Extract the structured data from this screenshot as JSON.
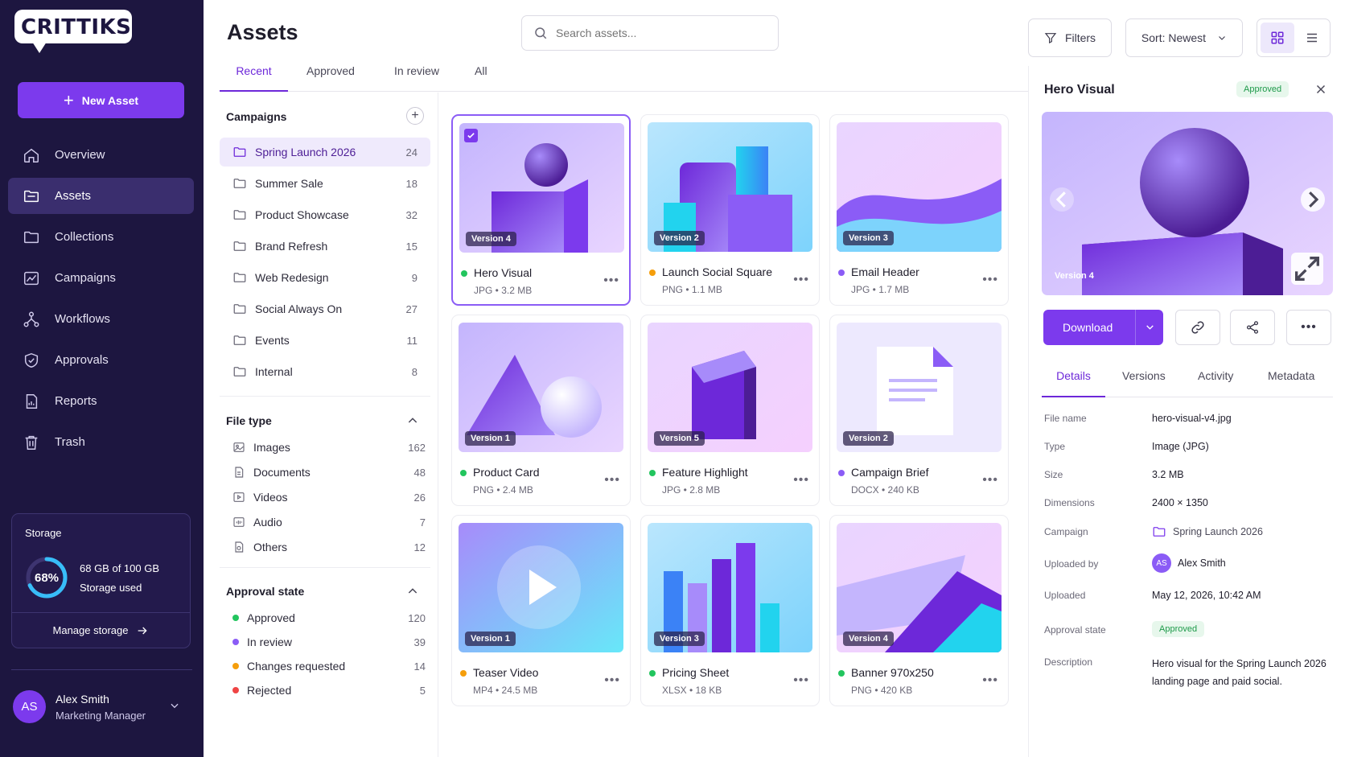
{
  "brand": {
    "logo_text": "CRITTIKS"
  },
  "sidebar": {
    "new_asset_label": "New Asset",
    "items": [
      {
        "label": "Overview",
        "icon": "home-icon"
      },
      {
        "label": "Assets",
        "icon": "folder-icon"
      },
      {
        "label": "Collections",
        "icon": "collection-icon"
      },
      {
        "label": "Campaigns",
        "icon": "campaign-icon"
      },
      {
        "label": "Workflows",
        "icon": "workflow-icon"
      },
      {
        "label": "Approvals",
        "icon": "shield-check-icon"
      },
      {
        "label": "Reports",
        "icon": "report-icon"
      },
      {
        "label": "Trash",
        "icon": "trash-icon"
      }
    ],
    "active_item": "Assets",
    "storage": {
      "title": "Storage",
      "percent": "68%",
      "used_fraction": 0.68,
      "used_text": "68 GB of 100 GB",
      "used_label": "Storage used",
      "manage_label": "Manage storage"
    },
    "user": {
      "initials": "AS",
      "name": "Alex Smith",
      "role": "Marketing Manager"
    }
  },
  "header": {
    "title": "Assets",
    "search_placeholder": "Search assets...",
    "filters_label": "Filters",
    "sort_label": "Sort: Newest"
  },
  "tabs": [
    {
      "label": "Recent",
      "active": true
    },
    {
      "label": "Approved",
      "active": false
    },
    {
      "label": "In review",
      "active": false
    },
    {
      "label": "All",
      "active": false
    }
  ],
  "campaigns": {
    "heading": "Campaigns",
    "items": [
      {
        "name": "Spring Launch 2026",
        "count": "24",
        "active": true
      },
      {
        "name": "Summer Sale",
        "count": "18"
      },
      {
        "name": "Product Showcase",
        "count": "32"
      },
      {
        "name": "Brand Refresh",
        "count": "15"
      },
      {
        "name": "Web Redesign",
        "count": "9"
      },
      {
        "name": "Social Always On",
        "count": "27"
      },
      {
        "name": "Events",
        "count": "11"
      },
      {
        "name": "Internal",
        "count": "8"
      }
    ]
  },
  "file_type": {
    "heading": "File type",
    "items": [
      {
        "name": "Images",
        "count": "162"
      },
      {
        "name": "Documents",
        "count": "48"
      },
      {
        "name": "Videos",
        "count": "26"
      },
      {
        "name": "Audio",
        "count": "7"
      },
      {
        "name": "Others",
        "count": "12"
      }
    ]
  },
  "approval_state": {
    "heading": "Approval state",
    "items": [
      {
        "name": "Approved",
        "count": "120",
        "color": "#22c55e"
      },
      {
        "name": "In review",
        "count": "39",
        "color": "#8b5cf6"
      },
      {
        "name": "Changes requested",
        "count": "14",
        "color": "#f59e0b"
      },
      {
        "name": "Rejected",
        "count": "5",
        "color": "#ef4444"
      }
    ]
  },
  "assets": [
    {
      "title": "Hero Visual",
      "meta": "JPG • 3.2 MB",
      "version": "Version 4",
      "status_color": "#22c55e",
      "selected": true
    },
    {
      "title": "Launch Social Square",
      "meta": "PNG • 1.1 MB",
      "version": "Version 2",
      "status_color": "#f59e0b"
    },
    {
      "title": "Email Header",
      "meta": "JPG • 1.7 MB",
      "version": "Version 3",
      "status_color": "#8b5cf6"
    },
    {
      "title": "Product Card",
      "meta": "PNG • 2.4 MB",
      "version": "Version 1",
      "status_color": "#22c55e"
    },
    {
      "title": "Feature Highlight",
      "meta": "JPG • 2.8 MB",
      "version": "Version 5",
      "status_color": "#22c55e"
    },
    {
      "title": "Campaign Brief",
      "meta": "DOCX • 240 KB",
      "version": "Version 2",
      "status_color": "#8b5cf6"
    },
    {
      "title": "Teaser Video",
      "meta": "MP4 • 24.5 MB",
      "version": "Version 1",
      "status_color": "#f59e0b"
    },
    {
      "title": "Pricing Sheet",
      "meta": "XLSX • 18 KB",
      "version": "Version 3",
      "status_color": "#22c55e"
    },
    {
      "title": "Banner 970x250",
      "meta": "PNG • 420 KB",
      "version": "Version 4",
      "status_color": "#22c55e"
    }
  ],
  "detail": {
    "title": "Hero Visual",
    "badge": "Approved",
    "version": "Version 4",
    "download_label": "Download",
    "tabs": [
      "Details",
      "Versions",
      "Activity",
      "Metadata"
    ],
    "fields": {
      "file_name_label": "File name",
      "file_name": "hero-visual-v4.jpg",
      "type_label": "Type",
      "type": "Image (JPG)",
      "size_label": "Size",
      "size": "3.2 MB",
      "dimensions_label": "Dimensions",
      "dimensions": "2400 × 1350",
      "campaign_label": "Campaign",
      "campaign": "Spring Launch 2026",
      "uploaded_by_label": "Uploaded by",
      "uploaded_by": "Alex Smith",
      "uploaded_by_initials": "AS",
      "uploaded_label": "Uploaded",
      "uploaded": "May 12, 2026, 10:42 AM",
      "approval_label": "Approval state",
      "approval": "Approved",
      "description_label": "Description",
      "description": "Hero visual for the Spring Launch 2026 landing page and paid social."
    }
  },
  "colors": {
    "accent": "#7c3aed",
    "sidebar_bg": "#1d1640",
    "approved": "#22c55e",
    "review": "#8b5cf6",
    "changes": "#f59e0b",
    "rejected": "#ef4444"
  }
}
